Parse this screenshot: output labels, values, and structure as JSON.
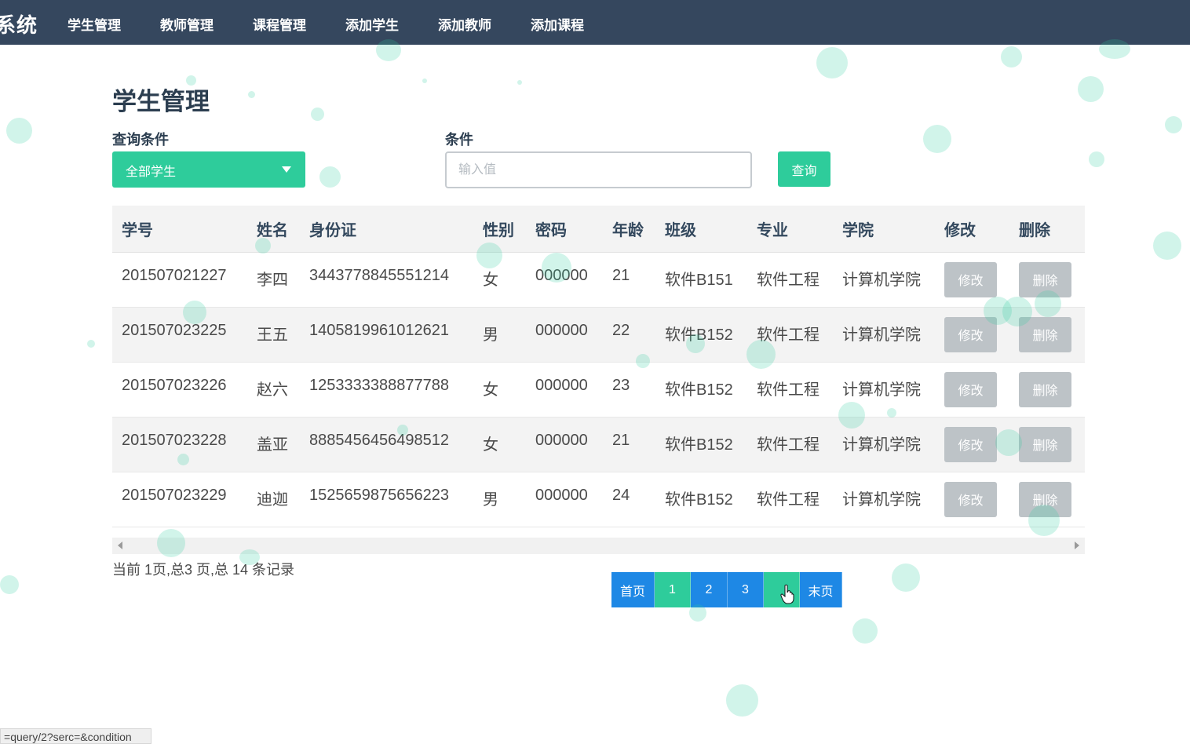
{
  "navbar": {
    "brand": "系统",
    "items": [
      "学生管理",
      "教师管理",
      "课程管理",
      "添加学生",
      "添加教师",
      "添加课程"
    ]
  },
  "page_title": "学生管理",
  "filters": {
    "query_label": "查询条件",
    "query_selected": "全部学生",
    "condition_label": "条件",
    "condition_placeholder": "输入值",
    "submit_label": "查询"
  },
  "table": {
    "headers": [
      "学号",
      "姓名",
      "身份证",
      "性别",
      "密码",
      "年龄",
      "班级",
      "专业",
      "学院",
      "修改",
      "删除"
    ],
    "rows": [
      [
        "201507021227",
        "李四",
        "3443778845551214",
        "女",
        "000000",
        "21",
        "软件B151",
        "软件工程",
        "计算机学院"
      ],
      [
        "201507023225",
        "王五",
        "1405819961012621",
        "男",
        "000000",
        "22",
        "软件B152",
        "软件工程",
        "计算机学院"
      ],
      [
        "201507023226",
        "赵六",
        "1253333388877788",
        "女",
        "000000",
        "23",
        "软件B152",
        "软件工程",
        "计算机学院"
      ],
      [
        "201507023228",
        "盖亚",
        "8885456456498512",
        "女",
        "000000",
        "21",
        "软件B152",
        "软件工程",
        "计算机学院"
      ],
      [
        "201507023229",
        "迪迦",
        "1525659875656223",
        "男",
        "000000",
        "24",
        "软件B152",
        "软件工程",
        "计算机学院"
      ]
    ],
    "edit_label": "修改",
    "delete_label": "删除"
  },
  "pagination": {
    "info": "当前 1页,总3 页,总 14 条记录",
    "first": "首页",
    "pages": [
      "1",
      "2",
      "3"
    ],
    "next": "",
    "last": "末页"
  },
  "status_url": "query/2?serc=&condition=",
  "colors": {
    "navbar": "#35475e",
    "accent_green": "#2ecc9b",
    "pager_blue": "#1e88e5",
    "action_gray": "#bdc3c7"
  }
}
